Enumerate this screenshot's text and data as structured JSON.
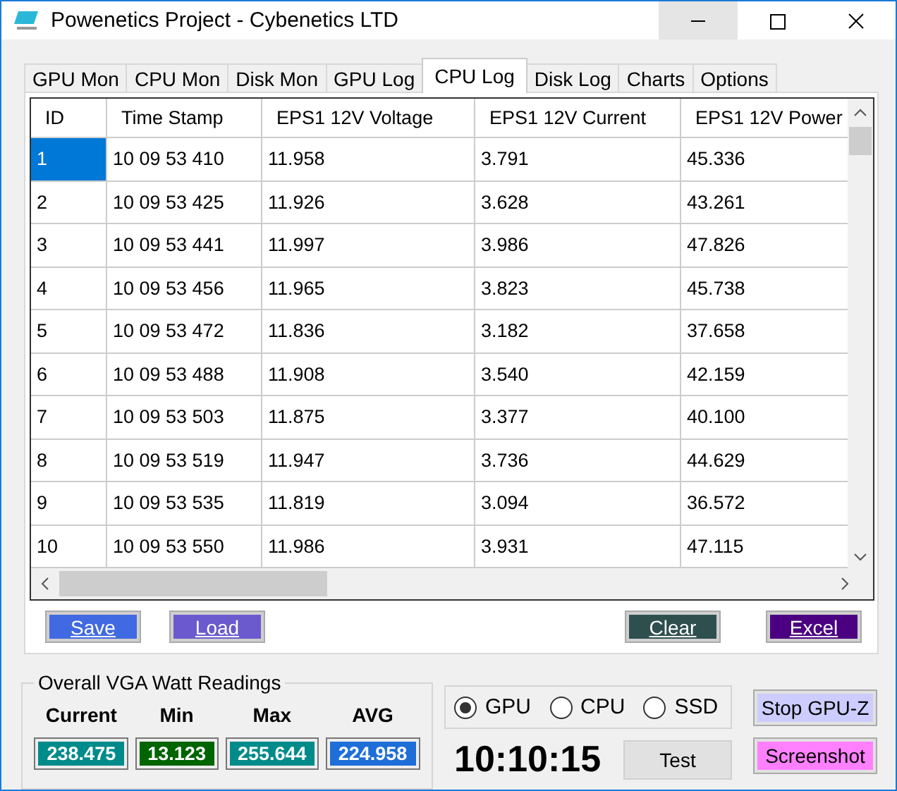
{
  "window": {
    "title": "Powenetics Project - Cybenetics LTD"
  },
  "tabs": [
    {
      "label": "GPU Mon",
      "selected": false
    },
    {
      "label": "CPU Mon",
      "selected": false
    },
    {
      "label": "Disk Mon",
      "selected": false
    },
    {
      "label": "GPU Log",
      "selected": false
    },
    {
      "label": "CPU Log",
      "selected": true
    },
    {
      "label": "Disk Log",
      "selected": false
    },
    {
      "label": "Charts",
      "selected": false
    },
    {
      "label": "Options",
      "selected": false
    }
  ],
  "table": {
    "columns": [
      "ID",
      "Time Stamp",
      "EPS1 12V Voltage",
      "EPS1 12V Current",
      "EPS1 12V Power"
    ],
    "rows": [
      {
        "selected": true,
        "cells": [
          "1",
          "10 09 53 410",
          "11.958",
          "3.791",
          "45.336"
        ]
      },
      {
        "selected": false,
        "cells": [
          "2",
          "10 09 53 425",
          "11.926",
          "3.628",
          "43.261"
        ]
      },
      {
        "selected": false,
        "cells": [
          "3",
          "10 09 53 441",
          "11.997",
          "3.986",
          "47.826"
        ]
      },
      {
        "selected": false,
        "cells": [
          "4",
          "10 09 53 456",
          "11.965",
          "3.823",
          "45.738"
        ]
      },
      {
        "selected": false,
        "cells": [
          "5",
          "10 09 53 472",
          "11.836",
          "3.182",
          "37.658"
        ]
      },
      {
        "selected": false,
        "cells": [
          "6",
          "10 09 53 488",
          "11.908",
          "3.540",
          "42.159"
        ]
      },
      {
        "selected": false,
        "cells": [
          "7",
          "10 09 53 503",
          "11.875",
          "3.377",
          "40.100"
        ]
      },
      {
        "selected": false,
        "cells": [
          "8",
          "10 09 53 519",
          "11.947",
          "3.736",
          "44.629"
        ]
      },
      {
        "selected": false,
        "cells": [
          "9",
          "10 09 53 535",
          "11.819",
          "3.094",
          "36.572"
        ]
      },
      {
        "selected": false,
        "cells": [
          "10",
          "10 09 53 550",
          "11.986",
          "3.931",
          "47.115"
        ]
      }
    ]
  },
  "left_buttons": [
    {
      "label": "Save",
      "color": "#4169e1"
    },
    {
      "label": "Load",
      "color": "#6a5acd"
    }
  ],
  "right_buttons": [
    {
      "label": "Clear",
      "color": "#2f4f4f"
    },
    {
      "label": "Excel",
      "color": "#4b0082"
    }
  ],
  "readings": {
    "title": "Overall VGA Watt Readings",
    "items": [
      {
        "label": "Current",
        "value": "238.475",
        "color": "#008b8b"
      },
      {
        "label": "Min",
        "value": "13.123",
        "color": "#006400"
      },
      {
        "label": "Max",
        "value": "255.644",
        "color": "#008b8b"
      },
      {
        "label": "AVG",
        "value": "224.958",
        "color": "#1e6ed8"
      }
    ]
  },
  "device_options": [
    {
      "label": "GPU",
      "selected": true
    },
    {
      "label": "CPU",
      "selected": false
    },
    {
      "label": "SSD",
      "selected": false
    }
  ],
  "clock": "10:10:15",
  "test_button": "Test",
  "side_buttons": [
    {
      "label": "Stop GPU-Z",
      "color": "#ccccff"
    },
    {
      "label": "Screenshot",
      "color": "#ff80ff"
    }
  ]
}
